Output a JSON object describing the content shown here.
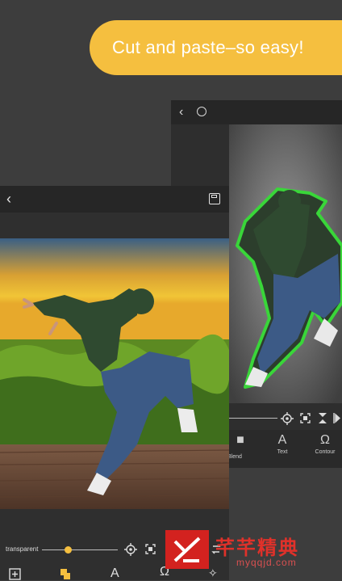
{
  "banner": {
    "text": "Cut and paste–so easy!"
  },
  "back_screen": {
    "tools": [
      {
        "icon": "layers-icon",
        "label": "Blend"
      },
      {
        "icon": "text-icon",
        "label": "Text"
      },
      {
        "icon": "contour-icon",
        "label": "Contour"
      }
    ]
  },
  "front_screen": {
    "transparent_label": "transparent",
    "transparency_value": 0.35,
    "tools": [
      {
        "icon": "add-image-icon"
      },
      {
        "icon": "layers-icon"
      },
      {
        "icon": "text-icon"
      },
      {
        "icon": "contour-icon"
      },
      {
        "icon": "magic-wand-icon"
      }
    ]
  },
  "watermark": {
    "title": "芊芊精典",
    "subtitle": "myqqjd.com"
  },
  "colors": {
    "accent": "#f5bf3f",
    "selection_outline": "#39d639",
    "background": "#3d3d3d"
  }
}
